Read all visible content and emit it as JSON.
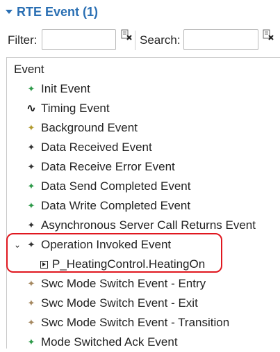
{
  "section": {
    "title": "RTE Event (1)"
  },
  "filter": {
    "label": "Filter:",
    "value": "",
    "placeholder": ""
  },
  "search": {
    "label": "Search:",
    "value": "",
    "placeholder": ""
  },
  "tree": {
    "root": "Event",
    "items": [
      {
        "label": "Init Event",
        "icon": "green-diamond-icon"
      },
      {
        "label": "Timing Event",
        "icon": "timing-wave-icon"
      },
      {
        "label": "Background Event",
        "icon": "olive-diamond-icon"
      },
      {
        "label": "Data Received Event",
        "icon": "dark-diamond-icon"
      },
      {
        "label": "Data Receive Error Event",
        "icon": "dark-diamond-icon"
      },
      {
        "label": "Data Send Completed Event",
        "icon": "green-diamond-icon"
      },
      {
        "label": "Data Write Completed Event",
        "icon": "green-diamond-icon"
      },
      {
        "label": "Asynchronous Server Call Returns Event",
        "icon": "dark-diamond-icon"
      },
      {
        "label": "Operation Invoked Event",
        "icon": "dark-diamond-icon",
        "expanded": true,
        "children": [
          {
            "label": "P_HeatingControl.HeatingOn",
            "icon": "operation-icon"
          }
        ]
      },
      {
        "label": "Swc Mode Switch Event - Entry",
        "icon": "tan-diamond-icon"
      },
      {
        "label": "Swc Mode Switch Event - Exit",
        "icon": "tan-diamond-icon"
      },
      {
        "label": "Swc Mode Switch Event - Transition",
        "icon": "tan-diamond-icon"
      },
      {
        "label": "Mode Switched Ack Event",
        "icon": "green-diamond-icon"
      }
    ]
  },
  "colors": {
    "accent": "#2a6fb3",
    "highlight": "#e0171f"
  }
}
